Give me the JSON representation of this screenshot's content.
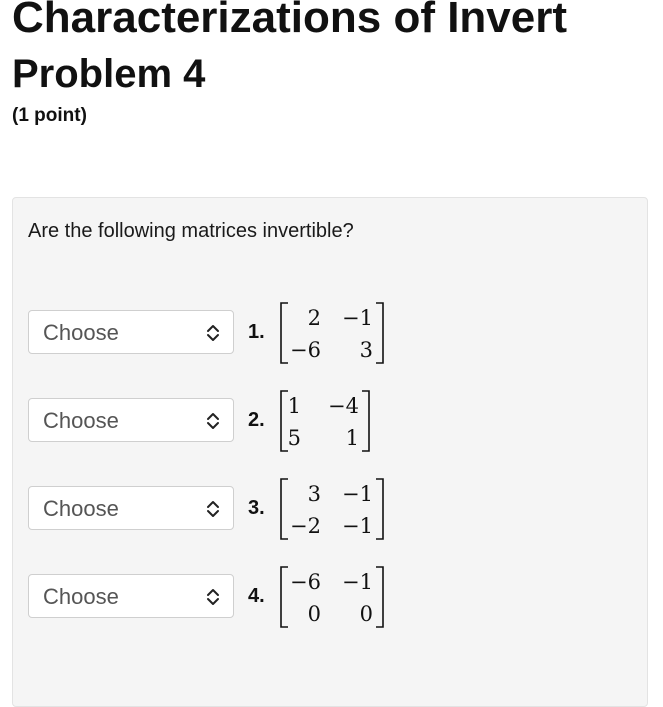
{
  "header": {
    "page_title": "Characterizations of Invert",
    "problem_title": "Problem 4",
    "points": "(1 point)"
  },
  "problem": {
    "prompt": "Are the following matrices invertible?",
    "items": [
      {
        "select_value": "Choose",
        "number": "1.",
        "matrix": [
          [
            "2",
            "−1"
          ],
          [
            "−6",
            "3"
          ]
        ]
      },
      {
        "select_value": "Choose",
        "number": "2.",
        "matrix": [
          [
            "1",
            "−4"
          ],
          [
            "5",
            "1"
          ]
        ]
      },
      {
        "select_value": "Choose",
        "number": "3.",
        "matrix": [
          [
            "3",
            "−1"
          ],
          [
            "−2",
            "−1"
          ]
        ]
      },
      {
        "select_value": "Choose",
        "number": "4.",
        "matrix": [
          [
            "−6",
            "−1"
          ],
          [
            "0",
            "0"
          ]
        ]
      }
    ]
  },
  "icons": {
    "select": "updown-chevron-icon"
  }
}
